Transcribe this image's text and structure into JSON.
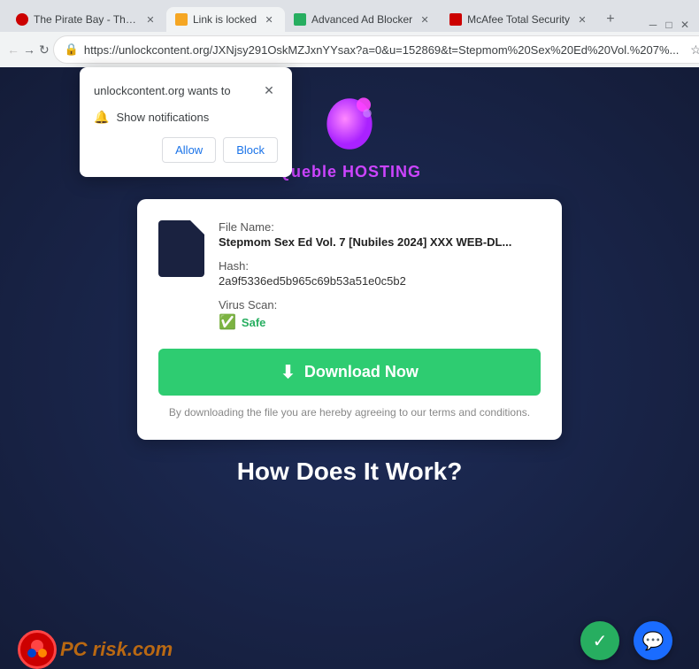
{
  "browser": {
    "tabs": [
      {
        "id": "tab1",
        "label": "The Pirate Bay - The g...",
        "favicon_type": "pirate",
        "active": false
      },
      {
        "id": "tab2",
        "label": "Link is locked",
        "favicon_type": "lock",
        "active": true
      },
      {
        "id": "tab3",
        "label": "Advanced Ad Blocker",
        "favicon_type": "shield",
        "active": false
      },
      {
        "id": "tab4",
        "label": "McAfee Total Security",
        "favicon_type": "mcafee",
        "active": false
      }
    ],
    "url": "https://unlockcontent.org/JXNjsy291OskMZJxnYYsax?a=0&u=152869&t=Stepmom%20Sex%20Ed%20Vol.%207%...",
    "nav": {
      "back_disabled": false,
      "forward_disabled": false
    }
  },
  "notification_popup": {
    "title": "unlockcontent.org wants to",
    "description": "Show notifications",
    "allow_label": "Allow",
    "block_label": "Block"
  },
  "page": {
    "logo_text": "Queble HOSTING",
    "file_info": {
      "file_name_label": "File Name:",
      "file_name_value": "Stepmom Sex Ed Vol. 7 [Nubiles 2024] XXX WEB-DL...",
      "hash_label": "Hash:",
      "hash_value": "2a9f5336ed5b965c69b53a51e0c5b2",
      "virus_scan_label": "Virus Scan:",
      "virus_scan_value": "Safe"
    },
    "download_button_label": "Download Now",
    "terms_text": "By downloading the file you are hereby agreeing to our terms and conditions.",
    "how_section_title": "How Does It Work?"
  }
}
